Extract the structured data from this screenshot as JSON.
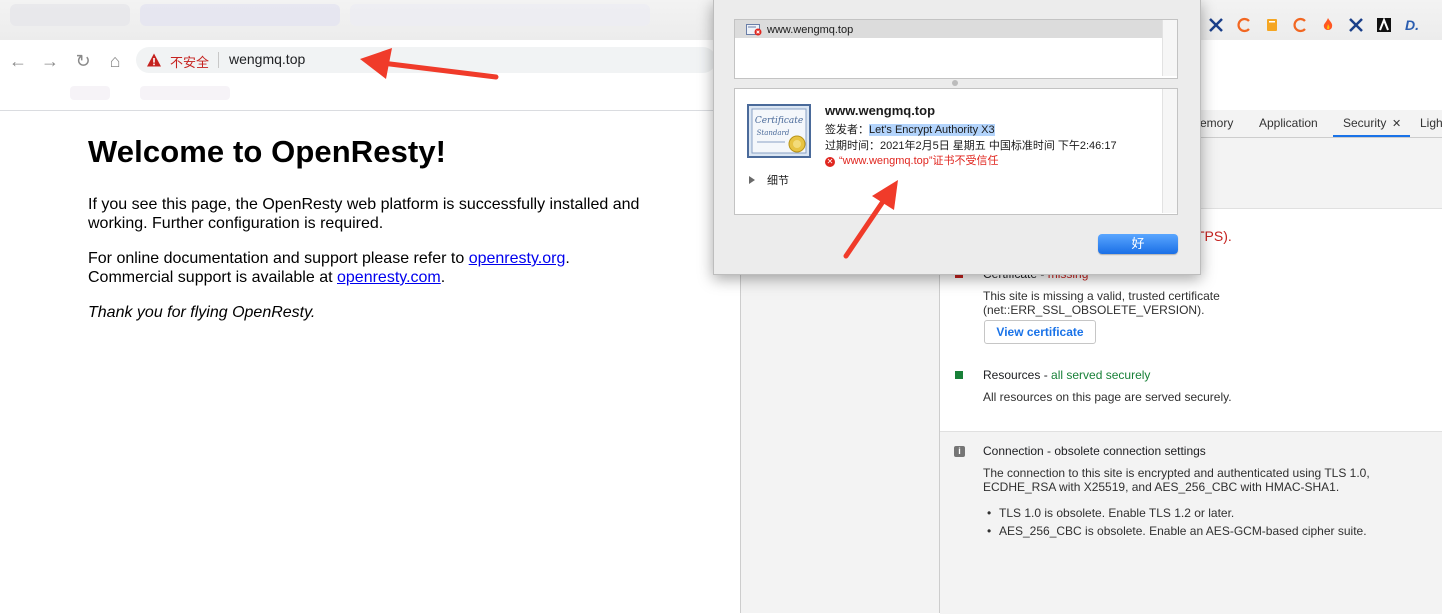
{
  "browser": {
    "nav": {
      "back": "←",
      "forward": "→",
      "reload": "↻",
      "home": "⌂"
    },
    "security_label": "不安全",
    "url": "wengmq.top"
  },
  "page": {
    "title": "Welcome to OpenResty!",
    "p1": "If you see this page, the OpenResty web platform is successfully installed and working. Further configuration is required.",
    "p2_prefix": "For online documentation and support please refer to ",
    "p2_link": "openresty.org",
    "p2_mid": ".",
    "p2_line2_prefix": "Commercial support is available at ",
    "p2_link2": "openresty.com",
    "p2_suffix": ".",
    "p3": "Thank you for flying OpenResty."
  },
  "devtools": {
    "tabs": [
      "Memory",
      "Application",
      "Security",
      "Ligh"
    ],
    "active_tab": "Security",
    "close_glyph": "✕",
    "summary_red_text": "TPS).",
    "certificate": {
      "title": "Certificate",
      "dash": " - ",
      "status": "missing",
      "desc": "This site is missing a valid, trusted certificate (net::ERR_SSL_OBSOLETE_VERSION).",
      "button": "View certificate"
    },
    "resources": {
      "title": "Resources",
      "dash": " - ",
      "status": "all served securely",
      "desc": "All resources on this page are served securely."
    },
    "connection": {
      "title": "Connection - obsolete connection settings",
      "desc": "The connection to this site is encrypted and authenticated using TLS 1.0, ECDHE_RSA with X25519, and AES_256_CBC with HMAC-SHA1.",
      "bullets": [
        "TLS 1.0 is obsolete. Enable TLS 1.2 or later.",
        "AES_256_CBC is obsolete. Enable an AES-GCM-based cipher suite."
      ]
    }
  },
  "cert_sheet": {
    "list_item": "www.wengmq.top",
    "name": "www.wengmq.top",
    "issuer_label": "签发者：",
    "issuer": "Let's Encrypt Authority X3",
    "expiry": "过期时间：2021年2月5日 星期五 中国标准时间 下午2:46:17",
    "error": "“www.wengmq.top”证书不受信任",
    "details": "细节",
    "ok_button": "好"
  },
  "extensions": [
    "tools-icon",
    "orange-c-icon",
    "book-icon",
    "orange-c-icon",
    "fire-icon",
    "tools-icon",
    "adobe-icon",
    "dict-icon"
  ],
  "colors": {
    "danger": "#c5221f",
    "secure": "#188038",
    "link": "#0000ee",
    "accent": "#1a73e8",
    "arrow": "#f03b2a"
  }
}
